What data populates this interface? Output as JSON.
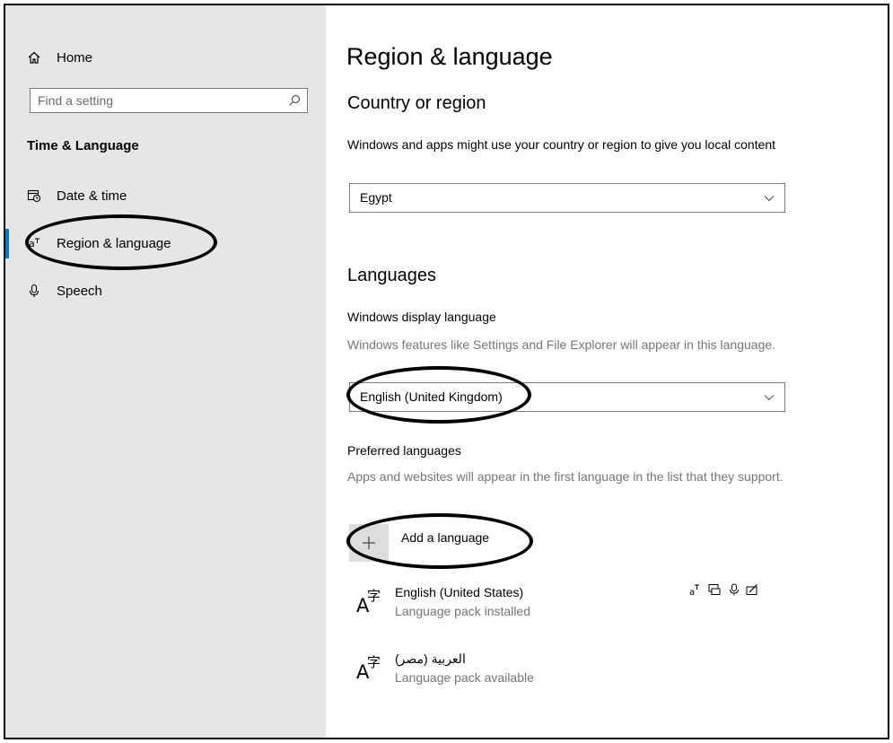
{
  "sidebar": {
    "home_label": "Home",
    "search_placeholder": "Find a setting",
    "section_title": "Time & Language",
    "items": [
      {
        "label": "Date & time"
      },
      {
        "label": "Region & language"
      },
      {
        "label": "Speech"
      }
    ]
  },
  "main": {
    "page_title": "Region & language",
    "country": {
      "heading": "Country or region",
      "description": "Windows and apps might use your country or region to give you local content",
      "selected": "Egypt"
    },
    "languages": {
      "heading": "Languages",
      "display_heading": "Windows display language",
      "display_description": "Windows features like Settings and File Explorer will appear in this language.",
      "display_selected": "English (United Kingdom)",
      "preferred_heading": "Preferred languages",
      "preferred_description": "Apps and websites will appear in the first language in the list that they support.",
      "add_label": "Add a language",
      "list": [
        {
          "name": "English (United States)",
          "status": "Language pack installed"
        },
        {
          "name": "العربية (مصر)",
          "status": "Language pack available"
        }
      ]
    }
  },
  "colors": {
    "sidebar_bg": "#e6e6e6",
    "accent": "#0078d7",
    "muted_text": "#767676"
  },
  "icons": [
    "home-icon",
    "search-icon",
    "calendar-clock-icon",
    "globe-language-icon",
    "microphone-icon",
    "chevron-down-icon",
    "plus-icon",
    "language-glyph-icon",
    "display-language-icon",
    "speech-feature-icon",
    "handwriting-icon"
  ]
}
